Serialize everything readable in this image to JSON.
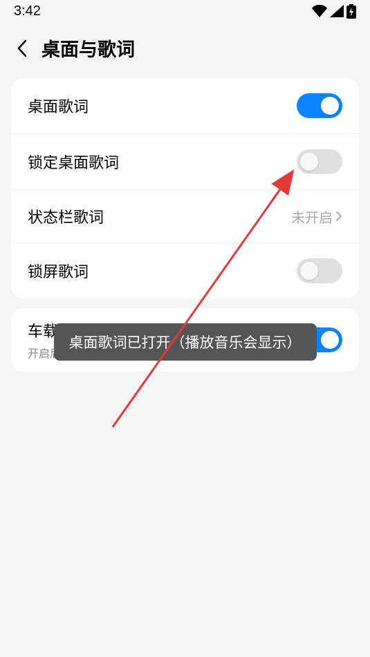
{
  "status": {
    "time": "3:42"
  },
  "header": {
    "title": "桌面与歌词"
  },
  "group1": {
    "row1": {
      "label": "桌面歌词",
      "toggle_on": true
    },
    "row2": {
      "label": "锁定桌面歌词",
      "toggle_on": false
    },
    "row3": {
      "label": "状态栏歌词",
      "value": "未开启"
    },
    "row4": {
      "label": "锁屏歌词",
      "toggle_on": false
    }
  },
  "group2": {
    "row1": {
      "label": "车载蓝牙歌词",
      "subtitle": "开启后",
      "toggle_on": true
    }
  },
  "toast": {
    "message": "桌面歌词已打开（播放音乐会显示）"
  }
}
